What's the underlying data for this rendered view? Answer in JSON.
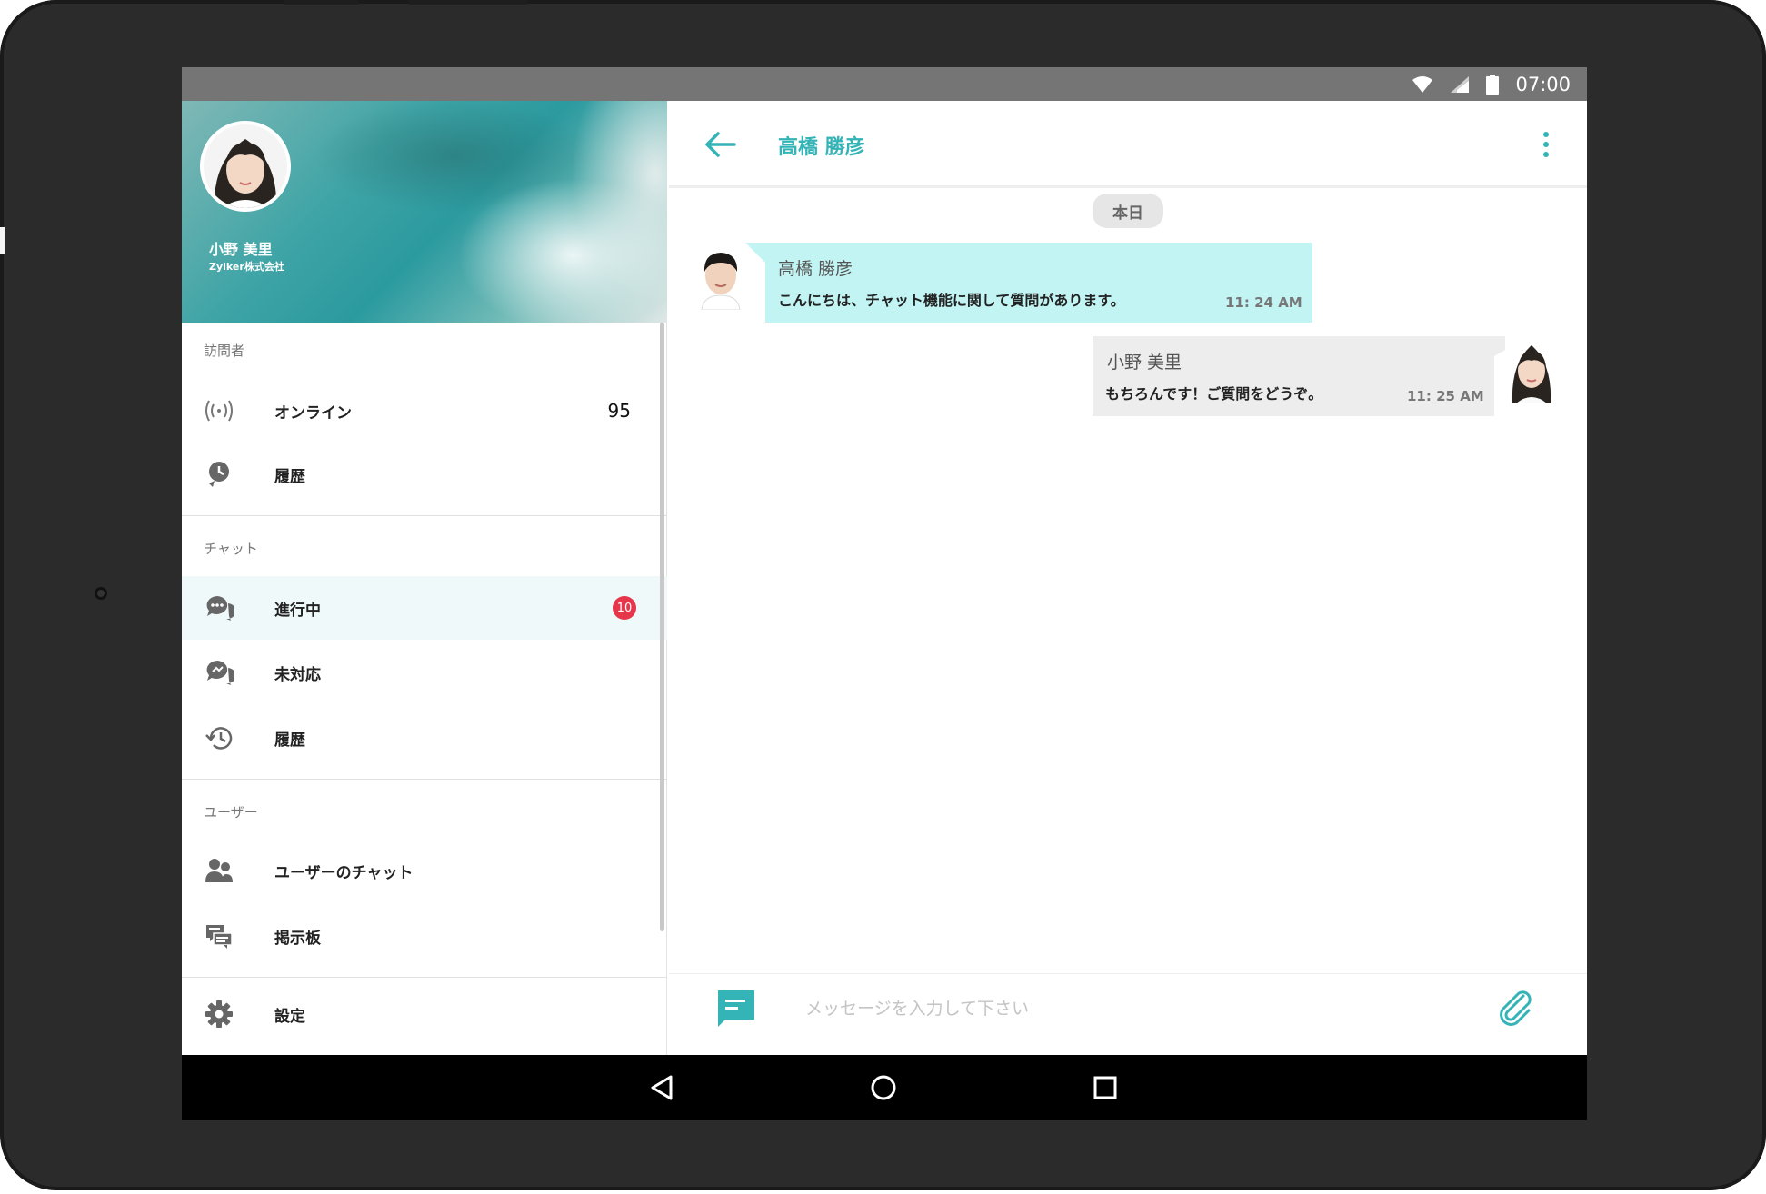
{
  "status_bar": {
    "time": "07:00",
    "icons": [
      "wifi-icon",
      "signal-icon",
      "battery-icon"
    ]
  },
  "profile": {
    "name": "小野 美里",
    "company": "Zylker株式会社"
  },
  "sidebar": {
    "sections": [
      {
        "header": "訪問者",
        "items": [
          {
            "label": "オンライン",
            "icon": "broadcast-icon",
            "count": "95"
          },
          {
            "label": "履歴",
            "icon": "visitor-history-icon"
          }
        ]
      },
      {
        "header": "チャット",
        "items": [
          {
            "label": "進行中",
            "icon": "chat-ongoing-icon",
            "badge": "10",
            "active": true
          },
          {
            "label": "未対応",
            "icon": "chat-missed-icon"
          },
          {
            "label": "履歴",
            "icon": "history-icon"
          }
        ]
      },
      {
        "header": "ユーザー",
        "items": [
          {
            "label": "ユーザーのチャット",
            "icon": "users-icon"
          },
          {
            "label": "掲示板",
            "icon": "feeds-icon"
          }
        ]
      }
    ],
    "settings_label": "設定"
  },
  "chat": {
    "title": "高橋 勝彦",
    "date_label": "本日",
    "messages": [
      {
        "sender": "高橋 勝彦",
        "text": "こんにちは、チャット機能に関して質問があります。",
        "time": "11: 24 AM",
        "direction": "incoming"
      },
      {
        "sender": "小野 美里",
        "text": "もちろんです！ご質問をどうぞ。",
        "time": "11: 25 AM",
        "direction": "outgoing"
      }
    ],
    "input_placeholder": "メッセージを入力して下さい"
  },
  "colors": {
    "accent": "#35b4b7",
    "incoming_bubble": "#c2f4f4",
    "outgoing_bubble": "#ededed",
    "badge": "#e5364b",
    "status_bar": "#757575",
    "device_frame": "#2b2b2b"
  }
}
